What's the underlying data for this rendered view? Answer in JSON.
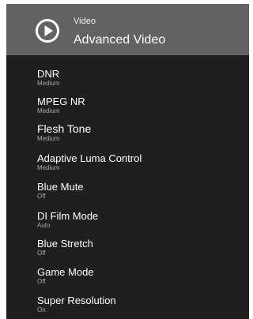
{
  "header": {
    "icon": "play-circle-icon",
    "category": "Video",
    "title": "Advanced Video"
  },
  "items": [
    {
      "label": "DNR",
      "value": "Medium"
    },
    {
      "label": "MPEG NR",
      "value": "Medium"
    },
    {
      "label": "Flesh Tone",
      "value": "Medium"
    },
    {
      "label": "Adaptive Luma Control",
      "value": "Medium"
    },
    {
      "label": "Blue Mute",
      "value": "Off"
    },
    {
      "label": "DI Film Mode",
      "value": "Auto"
    },
    {
      "label": "Blue Stretch",
      "value": "Off"
    },
    {
      "label": "Game Mode",
      "value": "Off"
    },
    {
      "label": "Super Resolution",
      "value": "On"
    }
  ],
  "colors": {
    "header_bg": "#626262",
    "panel_bg": "#1f1f1f",
    "label": "#ffffff",
    "value": "#a9a9a9"
  }
}
